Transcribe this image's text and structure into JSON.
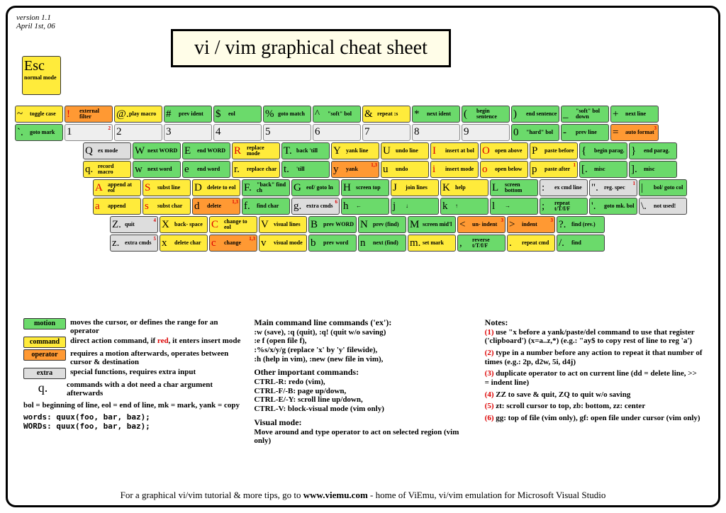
{
  "version": "version 1.1",
  "date": "April 1st, 06",
  "title": "vi / vim graphical cheat sheet",
  "esc": {
    "key": "Esc",
    "label": "normal mode"
  },
  "rows": [
    [
      {
        "c": "~",
        "l": "toggle case",
        "t": "command"
      },
      {
        "c": "!",
        "l": "external filter",
        "t": "operator",
        "red": 1
      },
      {
        "c": "@.",
        "l": "play macro",
        "t": "command"
      },
      {
        "c": "#",
        "l": "prev ident",
        "t": "motion"
      },
      {
        "c": "$",
        "l": "eol",
        "t": "motion"
      },
      {
        "c": "%",
        "l": "goto match",
        "t": "motion"
      },
      {
        "c": "^",
        "l": "\"soft\" bol",
        "t": "motion"
      },
      {
        "c": "&",
        "l": "repeat :s",
        "t": "command"
      },
      {
        "c": "*",
        "l": "next ident",
        "t": "motion"
      },
      {
        "c": "(",
        "l": "begin sentence",
        "t": "motion"
      },
      {
        "c": ")",
        "l": "end sentence",
        "t": "motion"
      },
      {
        "c": "_",
        "l": "\"soft\" bol down",
        "t": "motion"
      },
      {
        "c": "+",
        "l": "next line",
        "t": "motion"
      }
    ],
    [
      {
        "c": "`.",
        "l": "goto mark",
        "t": "motion"
      },
      {
        "c": "1",
        "num": 1,
        "sup": "2"
      },
      {
        "c": "2",
        "num": 1
      },
      {
        "c": "3",
        "num": 1
      },
      {
        "c": "4",
        "num": 1
      },
      {
        "c": "5",
        "num": 1
      },
      {
        "c": "6",
        "num": 1
      },
      {
        "c": "7",
        "num": 1
      },
      {
        "c": "8",
        "num": 1
      },
      {
        "c": "9",
        "num": 1
      },
      {
        "c": "0",
        "l": "\"hard\" bol",
        "t": "motion"
      },
      {
        "c": "-",
        "l": "prev line",
        "t": "motion"
      },
      {
        "c": "=",
        "l": "auto format",
        "t": "operator",
        "sup": "3"
      }
    ],
    [
      {
        "c": "Q",
        "l": "ex mode",
        "t": "extra"
      },
      {
        "c": "W",
        "l": "next WORD",
        "t": "motion"
      },
      {
        "c": "E",
        "l": "end WORD",
        "t": "motion"
      },
      {
        "c": "R",
        "l": "replace mode",
        "t": "command",
        "red": 1
      },
      {
        "c": "T.",
        "l": "back 'till",
        "t": "motion"
      },
      {
        "c": "Y",
        "l": "yank line",
        "t": "command"
      },
      {
        "c": "U",
        "l": "undo line",
        "t": "command"
      },
      {
        "c": "I",
        "l": "insert at bol",
        "t": "command",
        "red": 1
      },
      {
        "c": "O",
        "l": "open above",
        "t": "command",
        "red": 1
      },
      {
        "c": "P",
        "l": "paste before",
        "t": "command"
      },
      {
        "c": "{",
        "l": "begin parag.",
        "t": "motion"
      },
      {
        "c": "}",
        "l": "end parag.",
        "t": "motion"
      }
    ],
    [
      {
        "c": "q.",
        "l": "record macro",
        "t": "command"
      },
      {
        "c": "w",
        "l": "next word",
        "t": "motion"
      },
      {
        "c": "e",
        "l": "end word",
        "t": "motion"
      },
      {
        "c": "r.",
        "l": "replace char",
        "t": "command"
      },
      {
        "c": "t.",
        "l": "'till",
        "t": "motion"
      },
      {
        "c": "y",
        "l": "yank",
        "t": "operator",
        "sup": "1,3"
      },
      {
        "c": "u",
        "l": "undo",
        "t": "command"
      },
      {
        "c": "i",
        "l": "insert mode",
        "t": "command",
        "red": 1
      },
      {
        "c": "o",
        "l": "open below",
        "t": "command",
        "red": 1
      },
      {
        "c": "p",
        "l": "paste after",
        "t": "command",
        "sup": "1"
      },
      {
        "c": "[.",
        "l": "misc",
        "t": "motion"
      },
      {
        "c": "].",
        "l": "misc",
        "t": "motion"
      }
    ],
    [
      {
        "c": "A",
        "l": "append at eol",
        "t": "command",
        "red": 1
      },
      {
        "c": "S",
        "l": "subst line",
        "t": "command",
        "red": 1
      },
      {
        "c": "D",
        "l": "delete to eol",
        "t": "command"
      },
      {
        "c": "F.",
        "l": "\"back\" find ch",
        "t": "motion"
      },
      {
        "c": "G",
        "l": "eof/ goto ln",
        "t": "motion"
      },
      {
        "c": "H",
        "l": "screen top",
        "t": "motion"
      },
      {
        "c": "J",
        "l": "join lines",
        "t": "command"
      },
      {
        "c": "K",
        "l": "help",
        "t": "command"
      },
      {
        "c": "L",
        "l": "screen bottom",
        "t": "motion"
      },
      {
        "c": ":",
        "l": "ex cmd line",
        "t": "extra"
      },
      {
        "c": "\".",
        "l": "reg. spec",
        "t": "extra",
        "sup": "1"
      },
      {
        "c": "|",
        "l": "bol/ goto col",
        "t": "motion"
      }
    ],
    [
      {
        "c": "a",
        "l": "append",
        "t": "command",
        "red": 1
      },
      {
        "c": "s",
        "l": "subst char",
        "t": "command",
        "red": 1
      },
      {
        "c": "d",
        "l": "delete",
        "t": "operator",
        "sup": "1,3"
      },
      {
        "c": "f.",
        "l": "find char",
        "t": "motion"
      },
      {
        "c": "g.",
        "l": "extra cmds",
        "t": "extra",
        "sup": "6"
      },
      {
        "c": "h",
        "l": "←",
        "t": "motion",
        "arrow": 1
      },
      {
        "c": "j",
        "l": "↓",
        "t": "motion",
        "arrow": 1
      },
      {
        "c": "k",
        "l": "↑",
        "t": "motion",
        "arrow": 1
      },
      {
        "c": "l",
        "l": "→",
        "t": "motion",
        "arrow": 1
      },
      {
        "c": ";",
        "l": "repeat t/T/f/F",
        "t": "motion"
      },
      {
        "c": "'.",
        "l": "goto mk. bol",
        "t": "motion"
      },
      {
        "c": "\\.",
        "l": "not used!",
        "t": "extra"
      }
    ],
    [
      {
        "c": "Z.",
        "l": "quit",
        "t": "extra",
        "sup": "4"
      },
      {
        "c": "X",
        "l": "back- space",
        "t": "command"
      },
      {
        "c": "C",
        "l": "change to eol",
        "t": "command",
        "red": 1
      },
      {
        "c": "V",
        "l": "visual lines",
        "t": "command"
      },
      {
        "c": "B",
        "l": "prev WORD",
        "t": "motion"
      },
      {
        "c": "N",
        "l": "prev (find)",
        "t": "motion"
      },
      {
        "c": "M",
        "l": "screen mid'l",
        "t": "motion"
      },
      {
        "c": "<",
        "l": "un- indent",
        "t": "operator",
        "sup": "3"
      },
      {
        "c": ">",
        "l": "indent",
        "t": "operator",
        "sup": "3"
      },
      {
        "c": "?.",
        "l": "find (rev.)",
        "t": "motion"
      }
    ],
    [
      {
        "c": "z.",
        "l": "extra cmds",
        "t": "extra",
        "sup": "5"
      },
      {
        "c": "x",
        "l": "delete char",
        "t": "command"
      },
      {
        "c": "c",
        "l": "change",
        "t": "operator",
        "red": 1,
        "sup": "1,3"
      },
      {
        "c": "v",
        "l": "visual mode",
        "t": "command"
      },
      {
        "c": "b",
        "l": "prev word",
        "t": "motion"
      },
      {
        "c": "n",
        "l": "next (find)",
        "t": "motion"
      },
      {
        "c": "m.",
        "l": "set mark",
        "t": "command"
      },
      {
        "c": ",",
        "l": "reverse t/T/f/F",
        "t": "motion"
      },
      {
        "c": ".",
        "l": "repeat cmd",
        "t": "command"
      },
      {
        "c": "/.",
        "l": "find",
        "t": "motion"
      }
    ]
  ],
  "leg": [
    {
      "s": "motion",
      "t": "motion",
      "d": "moves the cursor, or defines the range for an operator"
    },
    {
      "s": "command",
      "t": "command",
      "d": "direct action command, if red, it enters insert mode"
    },
    {
      "s": "operator",
      "t": "operator",
      "d": "requires a motion afterwards, operates between cursor & destination"
    },
    {
      "s": "extra",
      "t": "extra",
      "d": "special functions, requires extra input"
    }
  ],
  "qnote": "commands with a dot need a char argument afterwards",
  "bol": "bol = beginning of line, eol = end of line, mk = mark, yank = copy",
  "words": "words:   quux(foo,  bar,  baz);",
  "WORDS": "WORDs: quux(foo,  bar,  baz);",
  "main_hd": "Main command line commands ('ex'):",
  "main": [
    " :w (save), :q (quit), :q! (quit w/o saving)",
    " :e f (open file f),",
    " :%s/x/y/g (replace 'x' by 'y' filewide),",
    " :h (help in vim), :new (new file in vim),"
  ],
  "other_hd": "Other important commands:",
  "other": [
    " CTRL-R: redo (vim),",
    " CTRL-F/-B: page up/down,",
    " CTRL-E/-Y: scroll line up/down,",
    " CTRL-V: block-visual mode (vim only)"
  ],
  "vis_hd": "Visual mode:",
  "vis": " Move around and type operator to act on selected region (vim only)",
  "notes_hd": "Notes:",
  "notes": [
    {
      "n": "(1)",
      "t": "use \"x before a yank/paste/del command to use that register ('clipboard') (x=a..z,*) (e.g.: \"ay$ to copy rest of line to reg 'a')"
    },
    {
      "n": "(2)",
      "t": "type in a number before any action to repeat it that number of times (e.g.: 2p, d2w, 5i, d4j)"
    },
    {
      "n": "(3)",
      "t": "duplicate operator to act on current line (dd = delete line, >> = indent line)"
    },
    {
      "n": "(4)",
      "t": "ZZ to save & quit, ZQ to quit w/o saving"
    },
    {
      "n": "(5)",
      "t": "zt: scroll cursor to top, zb: bottom, zz: center"
    },
    {
      "n": "(6)",
      "t": "gg: top of file (vim only), gf: open file under cursor (vim only)"
    }
  ],
  "footer1": "For a graphical vi/vim tutorial & more tips, go to  ",
  "footer2": "www.viemu.com",
  "footer3": "  - home of ViEmu, vi/vim emulation for Microsoft Visual Studio"
}
